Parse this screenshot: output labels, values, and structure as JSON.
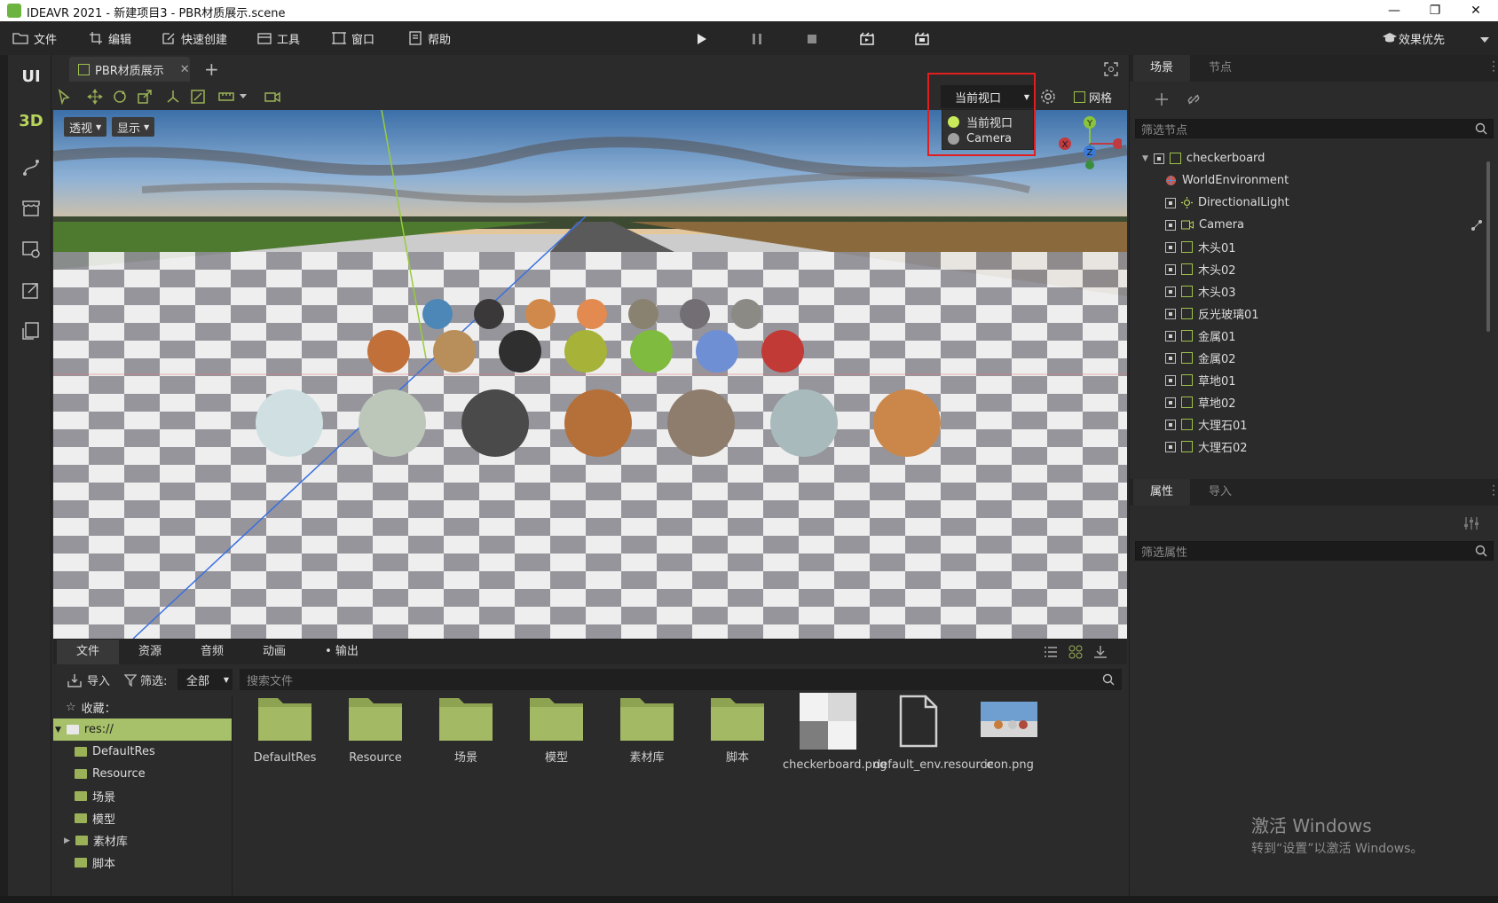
{
  "window": {
    "title": "IDEAVR 2021 - 新建项目3 - PBR材质展示.scene",
    "controls": [
      "—",
      "❐",
      "✕"
    ]
  },
  "menu": {
    "items": [
      "文件",
      "编辑",
      "快速创建",
      "工具",
      "窗口",
      "帮助"
    ],
    "quality": "效果优先"
  },
  "leftbar": {
    "ui_label": "UI",
    "d3_label": "3D"
  },
  "doc_tab": {
    "label": "PBR材质展示",
    "add": "+"
  },
  "viewport": {
    "persp_label": "透视",
    "display_label": "显示",
    "view_select": "当前视口",
    "view_options": [
      "当前视口",
      "Camera"
    ],
    "grid_label": "网格",
    "gizmo": {
      "x": "X",
      "y": "Y",
      "z": "Z"
    }
  },
  "scene_panel": {
    "tabs": [
      "场景",
      "节点"
    ],
    "filter_placeholder": "筛选节点",
    "nodes": [
      "checkerboard",
      "WorldEnvironment",
      "DirectionalLight",
      "Camera",
      "木头01",
      "木头02",
      "木头03",
      "反光玻璃01",
      "金属01",
      "金属02",
      "草地01",
      "草地02",
      "大理石01",
      "大理石02"
    ]
  },
  "props_panel": {
    "tabs": [
      "属性",
      "导入"
    ],
    "filter_placeholder": "筛选属性"
  },
  "bottom": {
    "tabs": [
      "文件",
      "资源",
      "音频",
      "动画",
      "输出"
    ],
    "import_label": "导入",
    "filter_label": "筛选:",
    "filter_value": "全部",
    "search_placeholder": "搜索文件",
    "favorites_label": "收藏：",
    "tree": [
      "res://",
      "DefaultRes",
      "Resource",
      "场景",
      "模型",
      "素材库",
      "脚本"
    ],
    "files": [
      {
        "name": "DefaultRes",
        "kind": "folder"
      },
      {
        "name": "Resource",
        "kind": "folder"
      },
      {
        "name": "场景",
        "kind": "folder"
      },
      {
        "name": "模型",
        "kind": "folder"
      },
      {
        "name": "素材库",
        "kind": "folder"
      },
      {
        "name": "脚本",
        "kind": "folder"
      },
      {
        "name": "checkerboard.png",
        "kind": "image"
      },
      {
        "name": "default_env.resource",
        "kind": "doc"
      },
      {
        "name": "icon.png",
        "kind": "photo"
      }
    ]
  },
  "activation": {
    "line1": "激活 Windows",
    "line2": "转到“设置”以激活 Windows。"
  },
  "colors": {
    "accent_green": "#9ab157",
    "highlight_red": "#e21d1d",
    "selected_row": "#a7c06a"
  }
}
